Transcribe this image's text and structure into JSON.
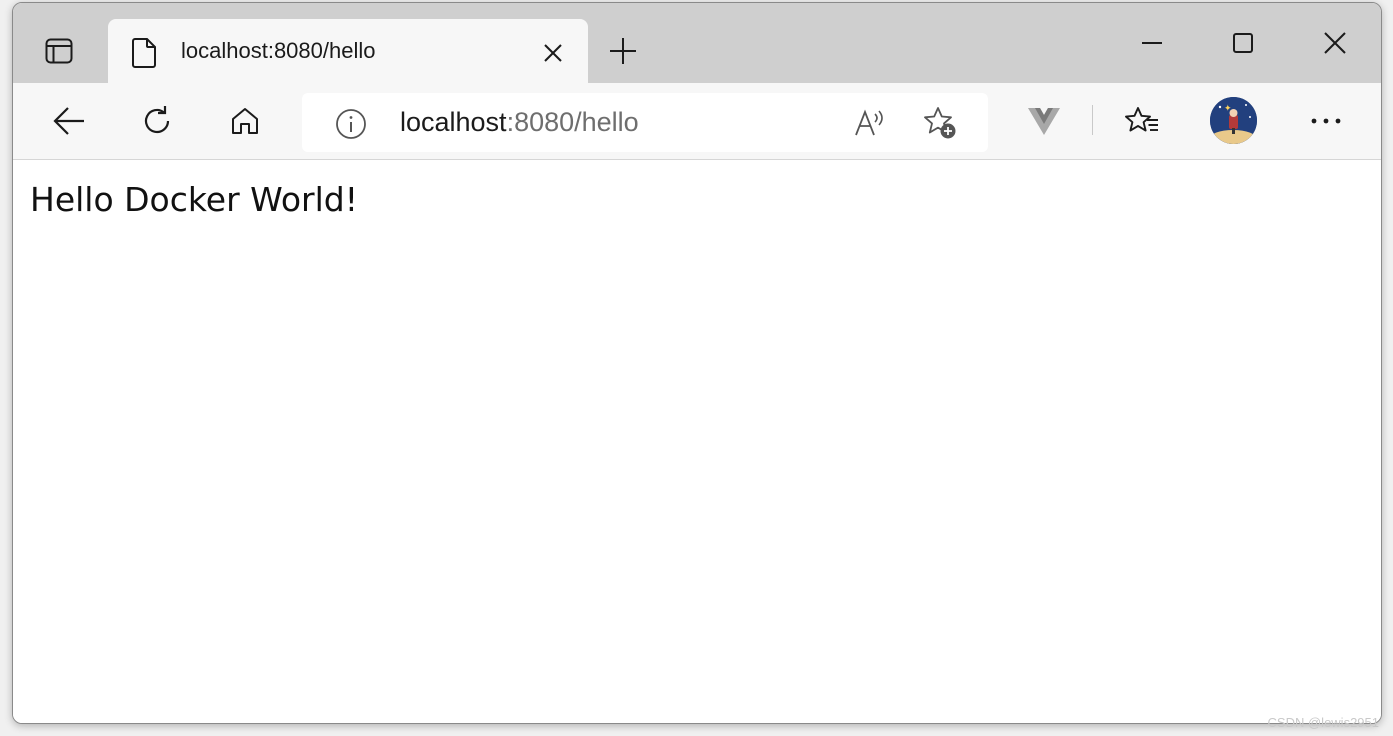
{
  "tab": {
    "title": "localhost:8080/hello",
    "favicon": "document-icon"
  },
  "address_bar": {
    "host": "localhost",
    "rest": ":8080/hello"
  },
  "page": {
    "heading": "Hello Docker World!"
  },
  "watermark": "CSDN @lewis2951",
  "icons": {
    "tab_actions": "tab-actions-icon",
    "close_tab": "close-icon",
    "new_tab": "plus-icon",
    "minimize": "minimize-icon",
    "maximize": "maximize-icon",
    "close_window": "close-icon",
    "back": "back-arrow-icon",
    "refresh": "refresh-icon",
    "home": "home-icon",
    "site_info": "info-icon",
    "read_aloud": "read-aloud-icon",
    "add_favorite": "add-favorite-icon",
    "extension": "vue-devtools-icon",
    "favorites": "favorites-icon",
    "profile": "profile-avatar",
    "more": "more-icon"
  },
  "colors": {
    "titlebar": "#cfcfcf",
    "toolbar": "#f7f7f7",
    "address_host": "#1b1b1b",
    "address_rest": "#6e6e6e"
  }
}
